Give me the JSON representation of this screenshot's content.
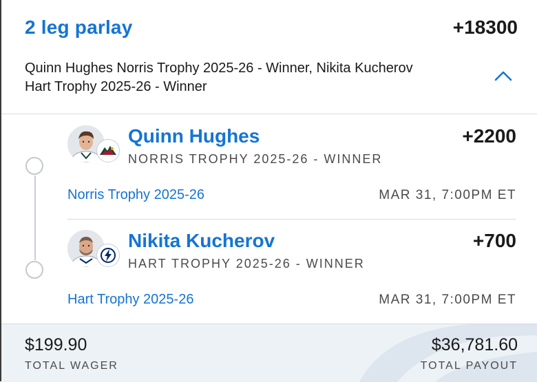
{
  "bet": {
    "title": "2 leg parlay",
    "total_odds": "+18300",
    "summary": "Quinn Hughes Norris Trophy 2025-26 - Winner, Nikita Kucherov Hart Trophy 2025-26 - Winner",
    "expanded": true
  },
  "legs": [
    {
      "player": "Quinn Hughes",
      "market": "NORRIS TROPHY 2025-26 - WINNER",
      "odds": "+2200",
      "event": "Norris Trophy 2025-26",
      "time": "MAR 31, 7:00PM ET",
      "team_logo": "minnesota-wild-logo-icon",
      "team_color": "#154734"
    },
    {
      "player": "Nikita Kucherov",
      "market": "HART TROPHY 2025-26 - WINNER",
      "odds": "+700",
      "event": "Hart Trophy 2025-26",
      "time": "MAR 31, 7:00PM ET",
      "team_logo": "tampa-bay-lightning-logo-icon",
      "team_color": "#002868"
    }
  ],
  "footer": {
    "wager_amount": "$199.90",
    "wager_label": "TOTAL WAGER",
    "payout_amount": "$36,781.60",
    "payout_label": "TOTAL PAYOUT"
  },
  "colors": {
    "accent": "#1474d4",
    "footer_bg": "#edf2f7"
  }
}
